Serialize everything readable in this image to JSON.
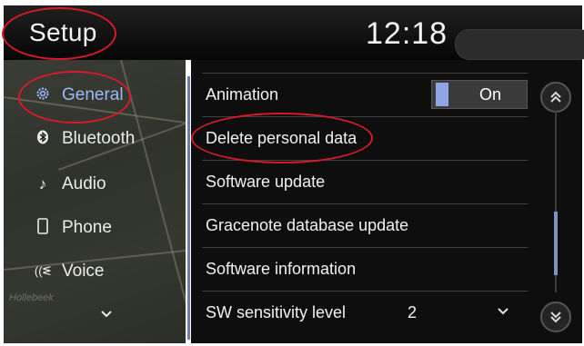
{
  "header": {
    "title": "Setup",
    "clock": "12:18"
  },
  "sidebar": {
    "items": [
      {
        "label": "General",
        "icon": "gear-icon",
        "active": true
      },
      {
        "label": "Bluetooth",
        "icon": "bluetooth-icon",
        "active": false
      },
      {
        "label": "Audio",
        "icon": "music-note-icon",
        "active": false
      },
      {
        "label": "Phone",
        "icon": "phone-icon",
        "active": false
      },
      {
        "label": "Voice",
        "icon": "voice-icon",
        "active": false
      }
    ],
    "more_icon": "chevron-down-icon",
    "map_labels": [
      "Hollebeek"
    ]
  },
  "list": {
    "rows": [
      {
        "label": "Animation",
        "toggle": "On"
      },
      {
        "label": "Delete personal data"
      },
      {
        "label": "Software update"
      },
      {
        "label": "Gracenote database update"
      },
      {
        "label": "Software information"
      },
      {
        "label": "SW sensitivity level",
        "value": "2"
      }
    ]
  },
  "scroll": {
    "up_icon": "double-chevron-up-icon",
    "down_icon": "double-chevron-down-icon",
    "position": 0.85
  },
  "colors": {
    "active": "#9fb7ff",
    "annotation": "#d8192a",
    "toggle_knob": "#8ea6e8"
  }
}
